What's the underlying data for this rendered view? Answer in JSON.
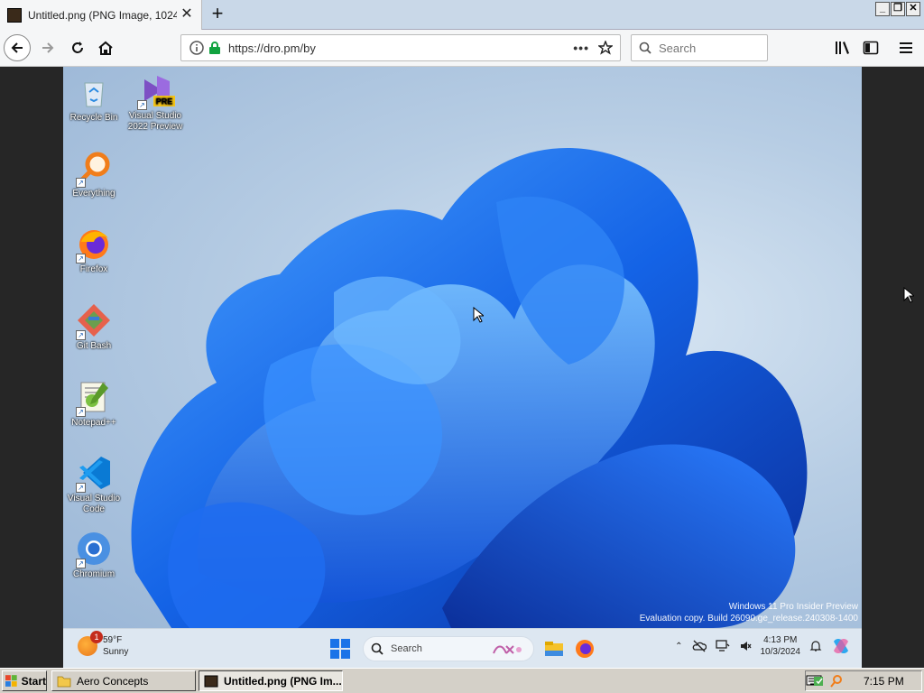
{
  "browser": {
    "tab_title": "Untitled.png (PNG Image, 1024 ×",
    "new_tab_label": "+",
    "url": "https://dro.pm/by",
    "url_more": "•••",
    "search_placeholder": "Search"
  },
  "desktop": {
    "icons": [
      {
        "label": "Recycle Bin"
      },
      {
        "label": "Visual Studio 2022 Preview",
        "badge": "PRE"
      },
      {
        "label": "Everything"
      },
      {
        "label": "Firefox"
      },
      {
        "label": "Git Bash"
      },
      {
        "label": "Notepad++"
      },
      {
        "label": "Visual Studio Code"
      },
      {
        "label": "Chromium"
      }
    ],
    "watermark_line1": "Windows 11 Pro Insider Preview",
    "watermark_line2": "Evaluation copy. Build 26090.ge_release.240308-1400"
  },
  "win11_taskbar": {
    "weather_temp": "59°F",
    "weather_cond": "Sunny",
    "weather_badge": "1",
    "search_label": "Search",
    "time": "4:13 PM",
    "date": "10/3/2024"
  },
  "taskbar": {
    "start_label": "Start",
    "tasks": [
      {
        "label": "Aero Concepts"
      },
      {
        "label": "Untitled.png (PNG Im..."
      }
    ],
    "clock": "7:15 PM"
  },
  "colors": {
    "bloom": "#1a5fd6",
    "taskbar_classic": "#d4d0c8"
  }
}
